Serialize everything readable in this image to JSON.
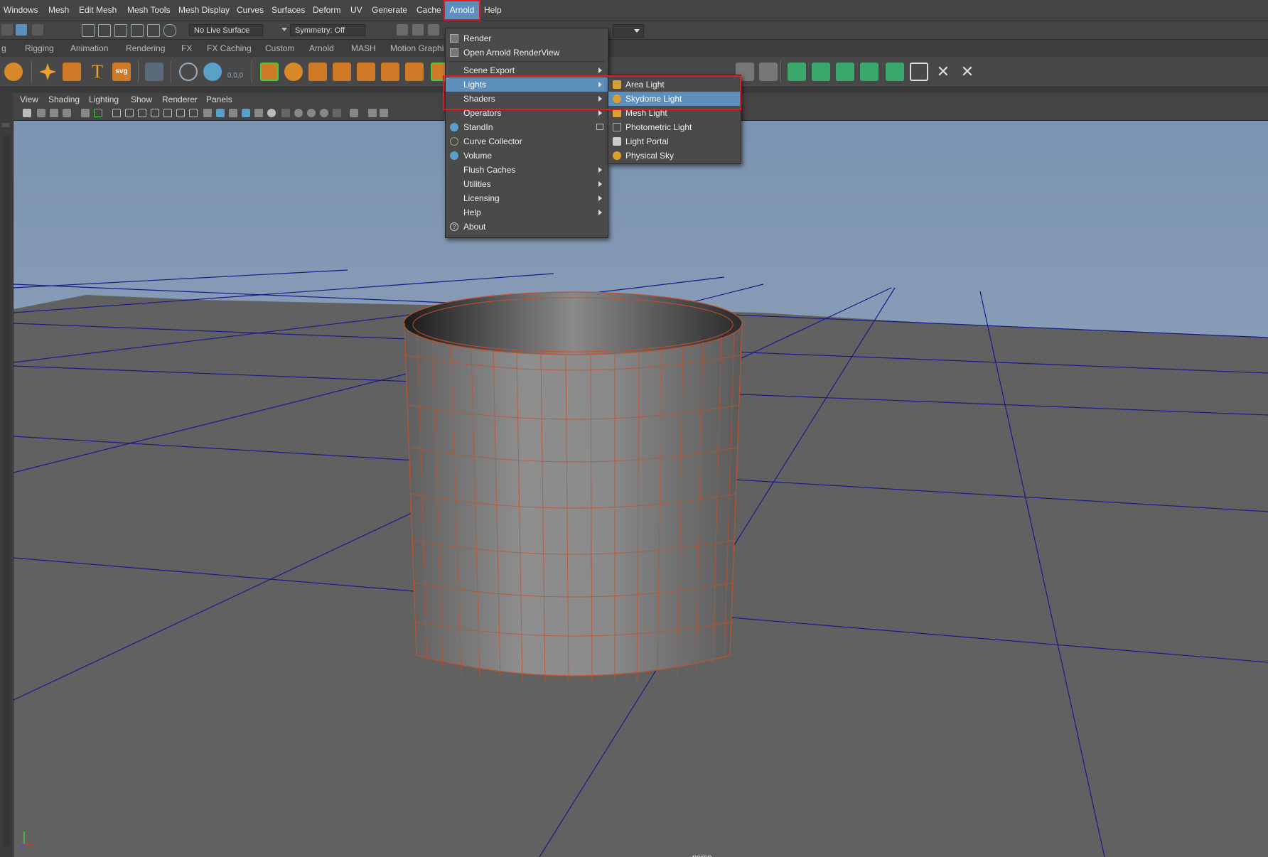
{
  "menubar": {
    "items": [
      "Windows",
      "Mesh",
      "Edit Mesh",
      "Mesh Tools",
      "Mesh Display",
      "Curves",
      "Surfaces",
      "Deform",
      "UV",
      "Generate",
      "Cache",
      "Arnold",
      "Help"
    ],
    "active": "Arnold"
  },
  "statusline": {
    "live_surface": "No Live Surface",
    "symmetry": "Symmetry: Off"
  },
  "shelf_tabs": [
    "g",
    "Rigging",
    "Animation",
    "Rendering",
    "FX",
    "FX Caching",
    "Custom",
    "Arnold",
    "MASH",
    "Motion Graphi"
  ],
  "shelf": {
    "svg_label": "svg",
    "coord_label": "0,0,0"
  },
  "panel_menu": [
    "View",
    "Shading",
    "Lighting",
    "Show",
    "Renderer",
    "Panels"
  ],
  "arnold_menu": {
    "items": [
      "Render",
      "Open Arnold RenderView",
      "Scene Export",
      "Lights",
      "Shaders",
      "Operators",
      "StandIn",
      "Curve Collector",
      "Volume",
      "Flush Caches",
      "Utilities",
      "Licensing",
      "Help",
      "About"
    ]
  },
  "lights_submenu": {
    "items": [
      "Area Light",
      "Skydome Light",
      "Mesh Light",
      "Photometric Light",
      "Light Portal",
      "Physical Sky"
    ],
    "highlighted": "Skydome Light"
  },
  "viewport": {
    "camera_label": "persp"
  },
  "colors": {
    "highlight": "#5d8fbd",
    "annotation": "#e01b24",
    "wire": "#c0522e",
    "grid": "#1a1a8c",
    "sky_top": "#7d95b3"
  }
}
